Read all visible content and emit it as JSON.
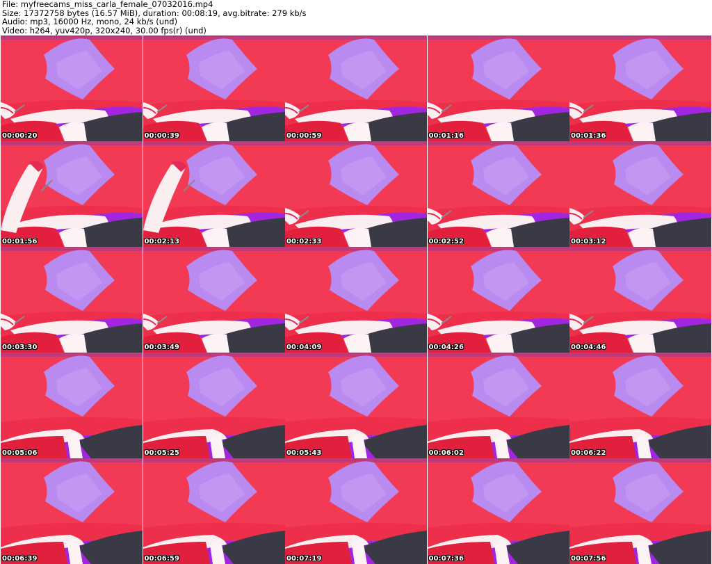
{
  "header": {
    "file_line": "File: myfreecams_miss_carla_female_07032016.mp4",
    "size_line": "Size: 17372758 bytes (16.57 MiB), duration: 00:08:19, avg.bitrate: 279 kb/s",
    "audio_line": "Audio: mp3, 16000 Hz, mono, 24 kb/s (und)",
    "video_line": "Video: h264, yuv420p, 320x240, 30.00 fps(r) (und)"
  },
  "colors": {
    "background_red": "#f2384f",
    "pillow_purple": "#b98af0",
    "sheet_violet": "#a226e0",
    "legging_dark": "#3a3a46"
  },
  "thumbnails": [
    {
      "timestamp": "00:00:20",
      "variant": "a"
    },
    {
      "timestamp": "00:00:39",
      "variant": "a"
    },
    {
      "timestamp": "00:00:59",
      "variant": "a"
    },
    {
      "timestamp": "00:01:16",
      "variant": "a"
    },
    {
      "timestamp": "00:01:36",
      "variant": "a"
    },
    {
      "timestamp": "00:01:56",
      "variant": "b"
    },
    {
      "timestamp": "00:02:13",
      "variant": "b"
    },
    {
      "timestamp": "00:02:33",
      "variant": "a"
    },
    {
      "timestamp": "00:02:52",
      "variant": "a"
    },
    {
      "timestamp": "00:03:12",
      "variant": "a"
    },
    {
      "timestamp": "00:03:30",
      "variant": "a"
    },
    {
      "timestamp": "00:03:49",
      "variant": "a"
    },
    {
      "timestamp": "00:04:09",
      "variant": "a"
    },
    {
      "timestamp": "00:04:26",
      "variant": "a"
    },
    {
      "timestamp": "00:04:46",
      "variant": "a"
    },
    {
      "timestamp": "00:05:06",
      "variant": "c"
    },
    {
      "timestamp": "00:05:25",
      "variant": "c"
    },
    {
      "timestamp": "00:05:43",
      "variant": "c"
    },
    {
      "timestamp": "00:06:02",
      "variant": "c"
    },
    {
      "timestamp": "00:06:22",
      "variant": "c"
    },
    {
      "timestamp": "00:06:39",
      "variant": "c"
    },
    {
      "timestamp": "00:06:59",
      "variant": "c"
    },
    {
      "timestamp": "00:07:19",
      "variant": "c"
    },
    {
      "timestamp": "00:07:36",
      "variant": "c"
    },
    {
      "timestamp": "00:07:56",
      "variant": "c"
    }
  ]
}
